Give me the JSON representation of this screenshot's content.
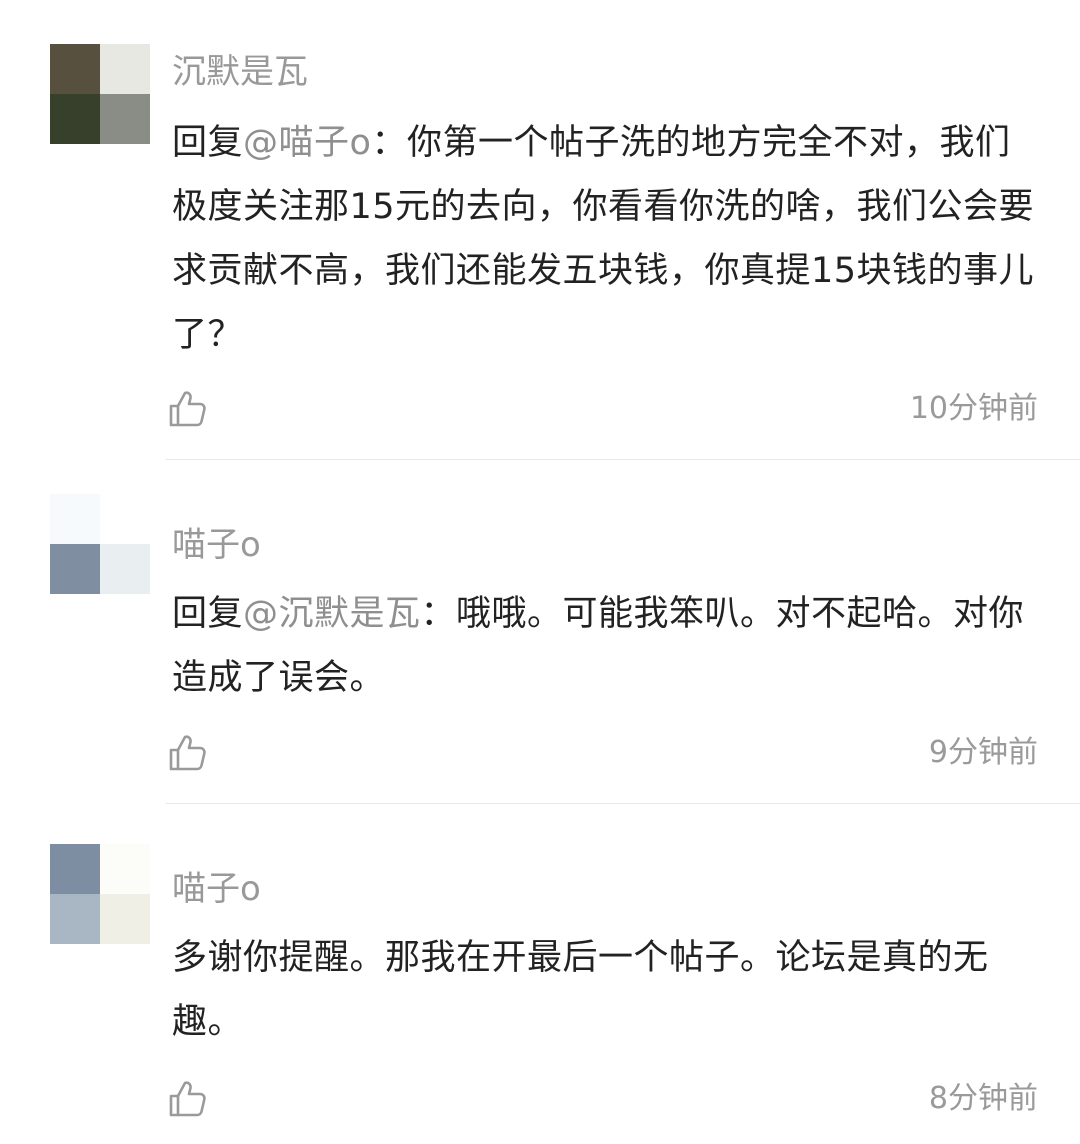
{
  "comments": [
    {
      "username": "沉默是瓦",
      "reply_prefix": "回复",
      "mention": "@喵子o",
      "colon": "：",
      "text": "你第一个帖子洗的地方完全不对，我们极度关注那15元的去向，你看看你洗的啥，我们公会要求贡献不高，我们还能发五块钱，你真提15块钱的事儿了？",
      "time": "10分钟前",
      "avatar_colors": [
        "#58503f",
        "#e8e8e2",
        "#37402a",
        "#8a8c86"
      ],
      "like_icon": "thumbs-up-icon"
    },
    {
      "username": "喵子o",
      "reply_prefix": "回复",
      "mention": "@沉默是瓦",
      "colon": "：",
      "text": "哦哦。可能我笨叭。对不起哈。对你造成了误会。",
      "time": "9分钟前",
      "avatar_colors": [
        "#f7fafc",
        "#ffffff",
        "#7f8ea0",
        "#e9eef0"
      ],
      "like_icon": "thumbs-up-icon"
    },
    {
      "username": "喵子o",
      "text": "多谢你提醒。那我在开最后一个帖子。论坛是真的无趣。",
      "time": "8分钟前",
      "avatar_colors": [
        "#7d8ea2",
        "#fcfcf8",
        "#a9b7c4",
        "#efefe6"
      ],
      "like_icon": "thumbs-up-icon"
    }
  ]
}
